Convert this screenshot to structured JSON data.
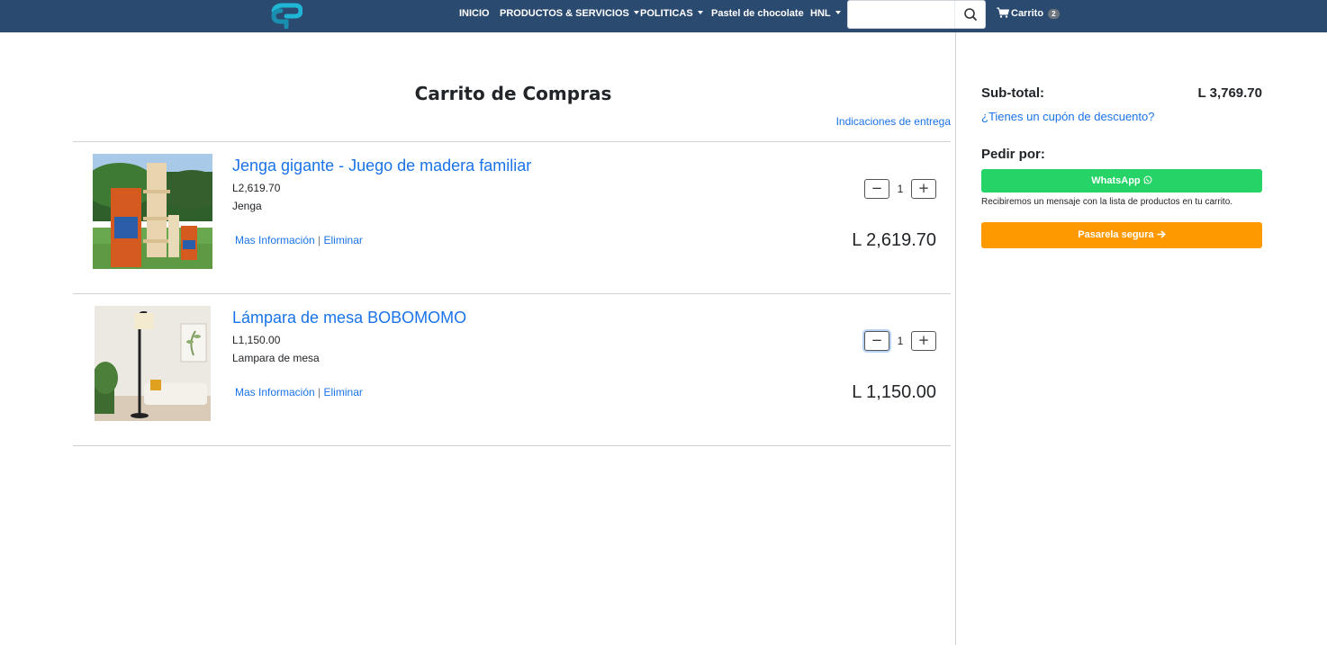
{
  "nav": {
    "logo_name": "sp-logo",
    "items": [
      {
        "label": "INICIO",
        "has_caret": false
      },
      {
        "label": "PRODUCTOS & SERVICIOS",
        "has_caret": true
      },
      {
        "label": "POLITICAS",
        "has_caret": true
      },
      {
        "label": "Pastel de chocolate",
        "has_caret": false
      },
      {
        "label": "HNL",
        "has_caret": true
      }
    ],
    "search": {
      "value": "",
      "placeholder": "",
      "icon": "search-icon"
    },
    "cart": {
      "label": "Carrito",
      "count": "2",
      "icon": "cart-icon"
    },
    "colors": {
      "background": "#2b4a6f",
      "text": "#ffffff"
    }
  },
  "main": {
    "title": "Carrito de Compras",
    "delivery_link": "Indicaciones de entrega",
    "items": [
      {
        "title": "Jenga gigante - Juego de madera familiar",
        "unit_price": "L2,619.70",
        "description": "Jenga",
        "more_info_label": "Mas Información",
        "separator": "|",
        "remove_label": "Eliminar",
        "quantity": "1",
        "total": "L 2,619.70",
        "image": "jenga-product-image"
      },
      {
        "title": "Lámpara de mesa BOBOMOMO",
        "unit_price": "L1,150.00",
        "description": "Lampara de mesa",
        "more_info_label": "Mas Información",
        "separator": "|",
        "remove_label": "Eliminar",
        "quantity": "1",
        "total": "L 1,150.00",
        "image": "lamp-product-image"
      }
    ],
    "link_color": "#1a73e8"
  },
  "sidebar": {
    "subtotal_label": "Sub-total:",
    "subtotal_value": "L 3,769.70",
    "coupon_link": "¿Tienes un cupón de descuento?",
    "order_by_label": "Pedir por:",
    "whatsapp_button": "WhatsApp",
    "whatsapp_note": "Recibiremos un mensaje con la lista de productos en tu carrito.",
    "gateway_button": "Pasarela segura",
    "colors": {
      "whatsapp": "#25d366",
      "gateway": "#ff9900"
    }
  }
}
